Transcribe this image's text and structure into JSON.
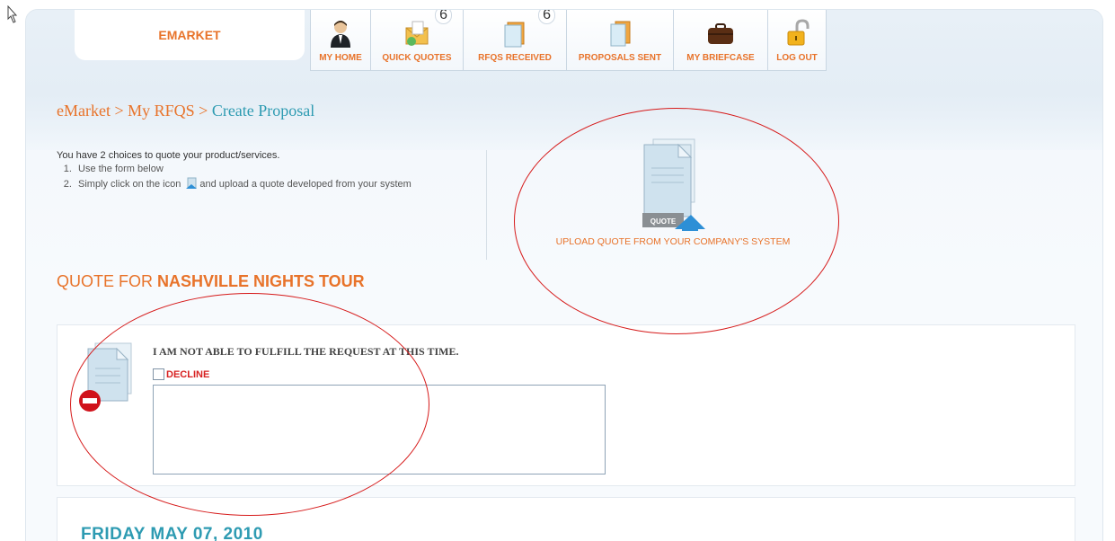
{
  "brand": {
    "name": "EMARKET"
  },
  "nav": {
    "items": [
      {
        "label": "MY HOME",
        "icon": "person-icon"
      },
      {
        "label": "QUICK QUOTES",
        "icon": "quick-quotes-icon",
        "badge": "6"
      },
      {
        "label": "RFQS RECEIVED",
        "icon": "rfqs-received-icon",
        "badge": "6"
      },
      {
        "label": "PROPOSALS SENT",
        "icon": "proposals-sent-icon"
      },
      {
        "label": "MY BRIEFCASE",
        "icon": "briefcase-icon"
      },
      {
        "label": "LOG OUT",
        "icon": "padlock-icon"
      }
    ]
  },
  "breadcrumb": {
    "part1": "eMarket",
    "sep1": " > ",
    "part2": "My RFQS",
    "sep2": " > ",
    "part3": "Create Proposal"
  },
  "intro": {
    "lead": "You have 2 choices to quote your product/services.",
    "step1": "Use the form below",
    "step2_before": "Simply click on the icon",
    "step2_after": "and upload a quote developed from your system"
  },
  "upload": {
    "icon_text": "QUOTE",
    "label": "UPLOAD QUOTE FROM YOUR COMPANY'S SYSTEM"
  },
  "quote_for": {
    "prefix": "QUOTE FOR ",
    "name": "NASHVILLE NIGHTS TOUR"
  },
  "decline": {
    "heading": "I AM NOT ABLE TO FULFILL THE REQUEST AT THIS TIME.",
    "checkbox_label": "DECLINE",
    "comment_value": ""
  },
  "date_section": {
    "date": "FRIDAY MAY 07, 2010"
  },
  "colors": {
    "accent_orange": "#e8732a",
    "accent_teal": "#2e9bb2",
    "decline_red": "#d72020",
    "annotation_red": "#d61a1a"
  }
}
